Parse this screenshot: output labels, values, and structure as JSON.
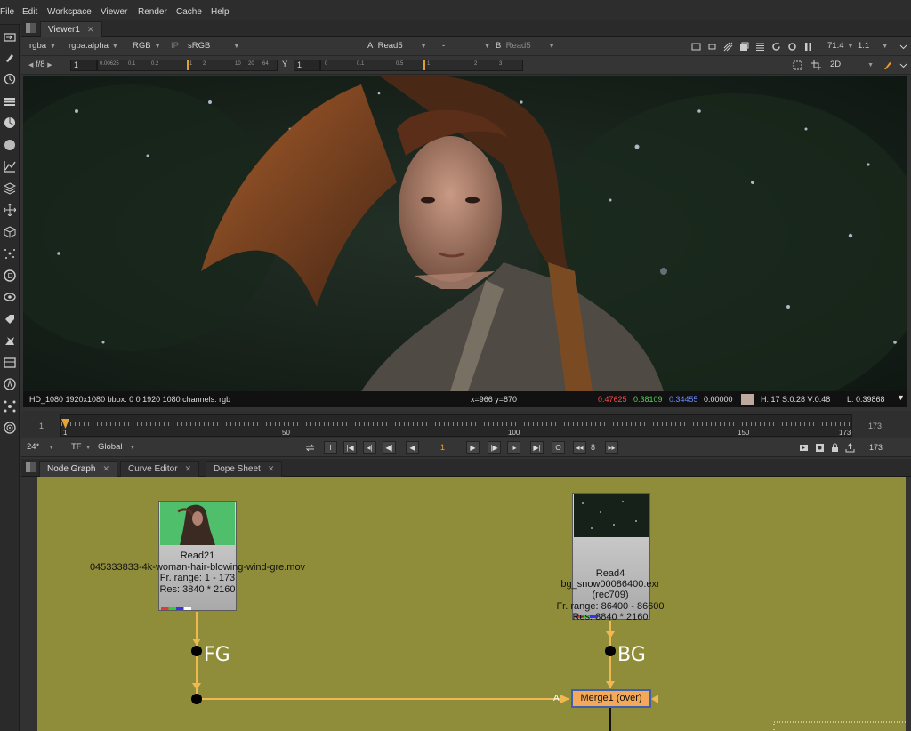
{
  "menu": [
    "File",
    "Edit",
    "Workspace",
    "Viewer",
    "Render",
    "Cache",
    "Help"
  ],
  "viewer_tab": {
    "label": "Viewer1",
    "close": "✕"
  },
  "viewer_controls": {
    "channels": "rgba",
    "alpha": "rgba.alpha",
    "color": "RGB",
    "ip": "IP",
    "lut": "sRGB",
    "input_a_label": "A",
    "input_a": "Read5",
    "wipe": "-",
    "input_b_label": "B",
    "input_b": "Read5",
    "zoom": "71.4",
    "ratio": "1:1",
    "mode": "2D"
  },
  "gain_row": {
    "fstop": "f/8",
    "gain_value": "1",
    "gain_ticks": [
      "0.00625",
      "0.1",
      "0.2",
      "1",
      "2",
      "10",
      "20",
      "64"
    ],
    "gamma_label": "Y",
    "gamma_value": "1",
    "gamma_ticks": [
      "0",
      "0.1",
      "0.5",
      "1",
      "2",
      "3"
    ]
  },
  "info_bar": {
    "format": "HD_1080 1920x1080  bbox: 0 0 1920 1080 channels: rgb",
    "coords": "x=966 y=870",
    "r": "0.47625",
    "g": "0.38109",
    "b": "0.34455",
    "a": "0.00000",
    "hsv": "H: 17 S:0.28 V:0.48",
    "lum": "L: 0.39868",
    "colors": {
      "r": "#ff4a4a",
      "g": "#58d058",
      "b": "#6c8cff",
      "swatch": "#bfa8a0"
    }
  },
  "timeline": {
    "start": "1",
    "end": "173",
    "current": "1",
    "ticks": [
      "1",
      "50",
      "100",
      "150",
      "173"
    ]
  },
  "playback": {
    "fps": "24*",
    "tf": "TF",
    "global": "Global",
    "frame": "1",
    "step": "8",
    "end_frame": "173",
    "inpoint": "I",
    "outpoint": "O"
  },
  "panel_tabs": [
    {
      "label": "Node Graph",
      "close": "✕"
    },
    {
      "label": "Curve Editor",
      "close": "✕"
    },
    {
      "label": "Dope Sheet",
      "close": "✕"
    }
  ],
  "nodes": {
    "read21": {
      "name": "Read21",
      "file": "045333833-4k-woman-hair-blowing-wind-gre.mov",
      "range": "Fr. range: 1 - 173",
      "res": "Res: 3840 * 2160"
    },
    "read4": {
      "name": "Read4",
      "file": "bg_snow00086400.exr",
      "space": "(rec709)",
      "range": "Fr. range: 86400 - 86600",
      "res": "Res: 3840 * 2160"
    },
    "merge": {
      "name": "Merge1 (over)",
      "input": "A"
    }
  },
  "pipes": {
    "fg": "FG",
    "bg": "BG"
  },
  "colors": {
    "node_graph_bg": "#908d3a",
    "pipe": "#f0b850",
    "merge_fill": "#f3a85a",
    "merge_border": "#3d5fb0"
  },
  "icons": [
    "panel-icon",
    "brush-icon",
    "clock-icon",
    "layers-icon",
    "color-icon",
    "circle-icon",
    "curve-icon",
    "stack-icon",
    "transform-icon",
    "3d-icon",
    "particle-icon",
    "deep-icon",
    "eye-icon",
    "tag-icon",
    "keyer-icon",
    "toolset-icon",
    "furnace-icon",
    "nodes-icon",
    "sphere-icon"
  ]
}
